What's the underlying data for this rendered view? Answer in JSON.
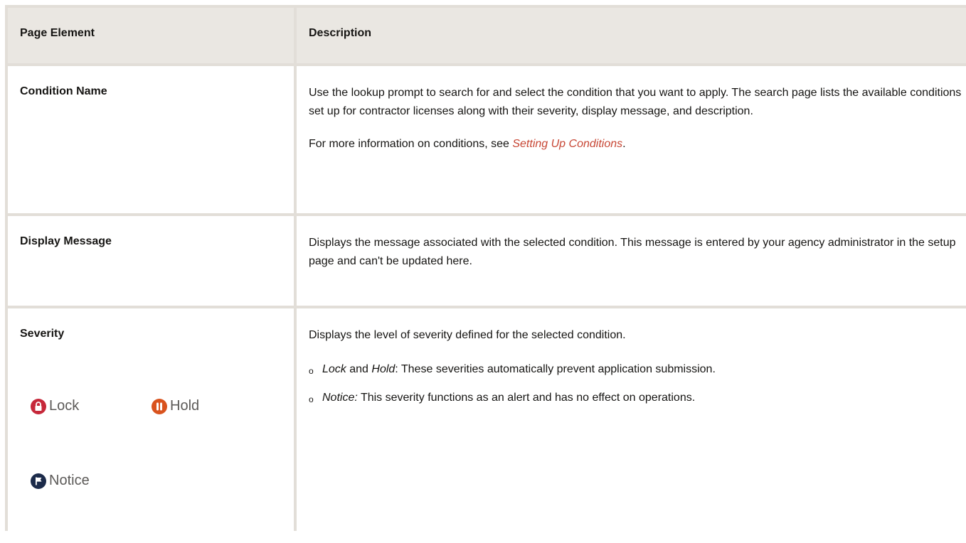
{
  "table": {
    "headers": [
      "Page Element",
      "Description"
    ],
    "rows": [
      {
        "name": "Condition Name",
        "desc_p1": "Use the lookup prompt to search for and select the condition that you want to apply. The search page lists the available conditions set up for contractor licenses along with their severity, display message, and description.",
        "desc_p2_prefix": "For more information on conditions, see ",
        "desc_p2_link": "Setting Up Conditions",
        "desc_p2_suffix": "."
      },
      {
        "name": "Display Message",
        "desc_p1": "Displays the message associated with the selected condition. This message is entered by your agency administrator in the setup page and can't be updated here."
      },
      {
        "name": "Severity",
        "desc_p1": "Displays the level of severity defined for the selected condition.",
        "bullets": [
          {
            "em1": "Lock",
            "mid": " and ",
            "em2": "Hold",
            "rest": ": These severities automatically prevent application submission."
          },
          {
            "em1": "Notice:",
            "rest": " This severity functions as an alert and has no effect on operations."
          }
        ],
        "badges": [
          {
            "label": "Lock",
            "icon": "lock-icon",
            "color": "#c6283a"
          },
          {
            "label": "Hold",
            "icon": "pause-icon",
            "color": "#d9531e"
          },
          {
            "label": "Notice",
            "icon": "flag-icon",
            "color": "#1c2b4a"
          }
        ]
      }
    ]
  },
  "colors": {
    "border": "#e2ded8",
    "header_bg": "#eae7e2",
    "link": "#c74634"
  },
  "bullet_glyph": "o"
}
